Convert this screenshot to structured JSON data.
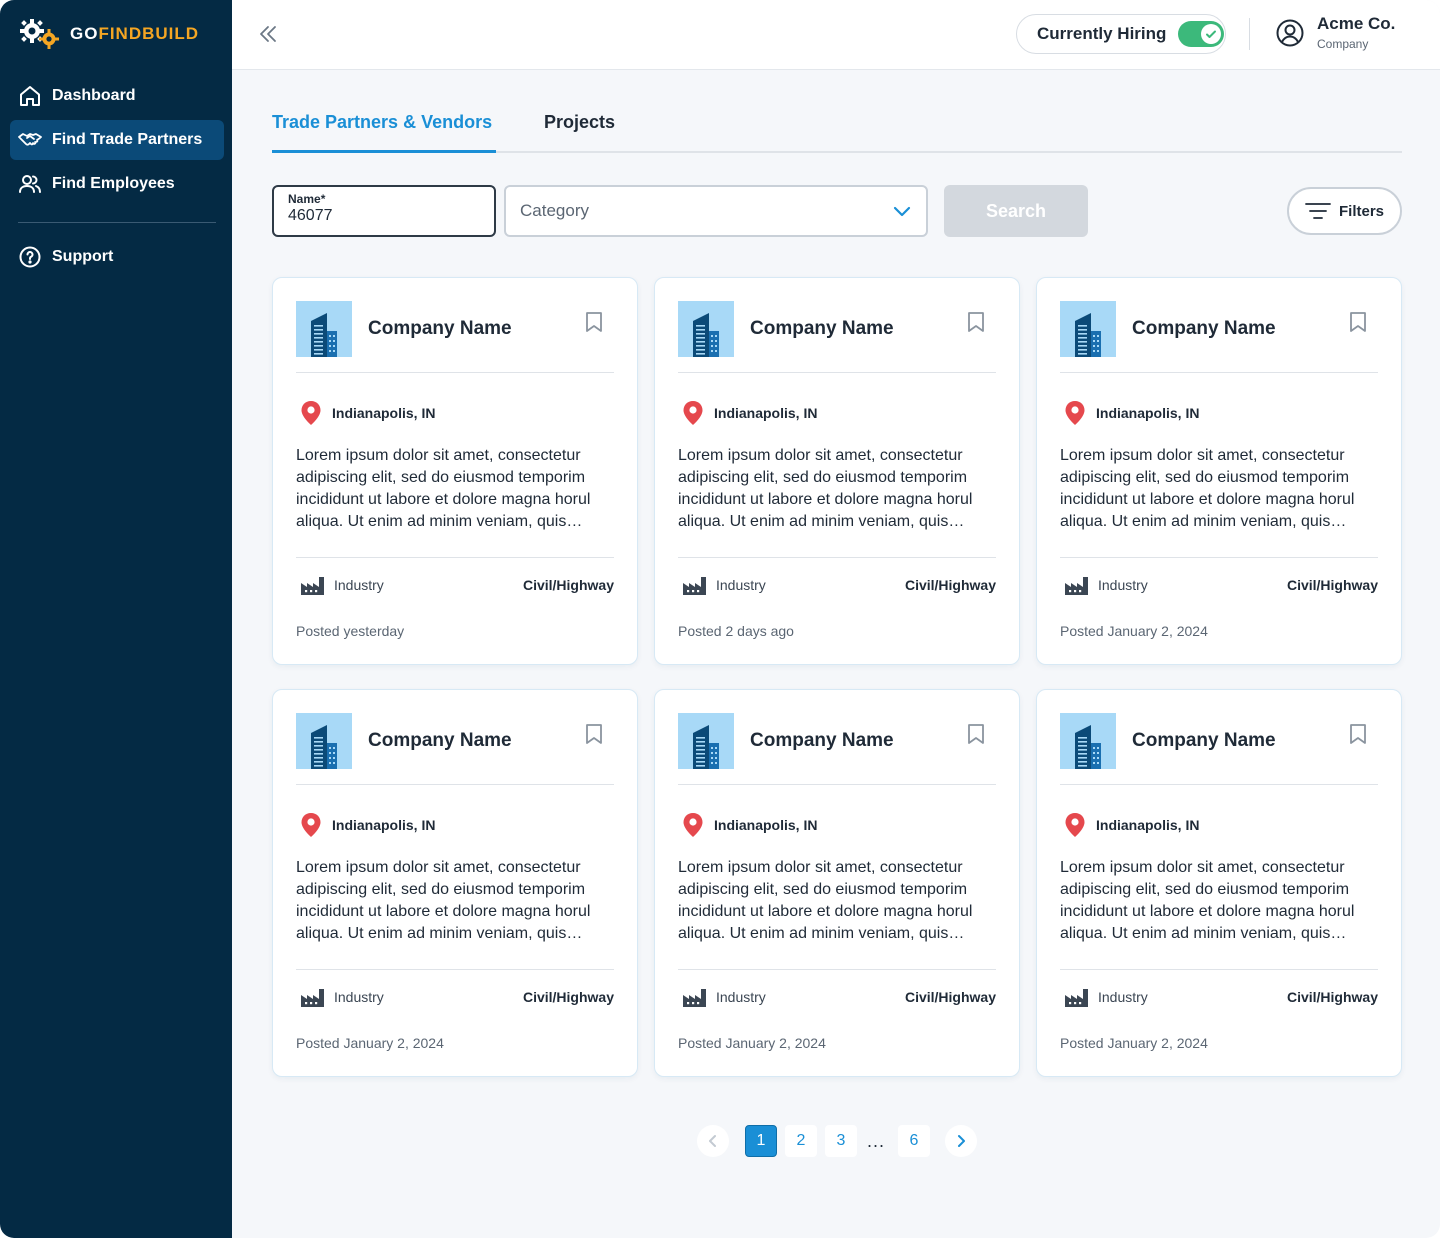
{
  "brand": {
    "part1": "GO",
    "part2": "FIND",
    "part3": "BUILD"
  },
  "sidebar": {
    "items": [
      {
        "label": "Dashboard",
        "icon": "home-icon"
      },
      {
        "label": "Find Trade Partners",
        "icon": "handshake-icon"
      },
      {
        "label": "Find Employees",
        "icon": "users-icon"
      }
    ],
    "support": {
      "label": "Support",
      "icon": "help-circle-icon"
    }
  },
  "topbar": {
    "hiring_label": "Currently Hiring",
    "hiring_on": true,
    "account_name": "Acme Co.",
    "account_role": "Company"
  },
  "tabs": [
    {
      "label": "Trade Partners & Vendors",
      "active": true
    },
    {
      "label": "Projects",
      "active": false
    }
  ],
  "search": {
    "name_label": "Name",
    "name_required": "*",
    "name_value": "46077",
    "category_placeholder": "Category",
    "search_label": "Search",
    "filters_label": "Filters"
  },
  "cards": [
    {
      "company": "Company Name",
      "location": "Indianapolis, IN",
      "description": "Lorem ipsum dolor sit amet, consectetur adipiscing elit, sed do eiusmod temporim incididunt ut labore et dolore magna horul aliqua. Ut enim ad minim veniam, quis nostrud",
      "industry_label": "Industry",
      "industry": "Civil/Highway",
      "posted": "Posted yesterday"
    },
    {
      "company": "Company Name",
      "location": "Indianapolis, IN",
      "description": "Lorem ipsum dolor sit amet, consectetur adipiscing elit, sed do eiusmod temporim incididunt ut labore et dolore magna horul aliqua. Ut enim ad minim veniam, quis nostrud",
      "industry_label": "Industry",
      "industry": "Civil/Highway",
      "posted": "Posted 2 days ago"
    },
    {
      "company": "Company Name",
      "location": "Indianapolis, IN",
      "description": "Lorem ipsum dolor sit amet, consectetur adipiscing elit, sed do eiusmod temporim incididunt ut labore et dolore magna horul aliqua. Ut enim ad minim veniam, quis nostrud",
      "industry_label": "Industry",
      "industry": "Civil/Highway",
      "posted": "Posted January 2, 2024"
    },
    {
      "company": "Company Name",
      "location": "Indianapolis, IN",
      "description": "Lorem ipsum dolor sit amet, consectetur adipiscing elit, sed do eiusmod temporim incididunt ut labore et dolore magna horul aliqua. Ut enim ad minim veniam, quis nostrud",
      "industry_label": "Industry",
      "industry": "Civil/Highway",
      "posted": "Posted January 2, 2024"
    },
    {
      "company": "Company Name",
      "location": "Indianapolis, IN",
      "description": "Lorem ipsum dolor sit amet, consectetur adipiscing elit, sed do eiusmod temporim incididunt ut labore et dolore magna horul aliqua. Ut enim ad minim veniam, quis nostrud",
      "industry_label": "Industry",
      "industry": "Civil/Highway",
      "posted": "Posted January 2, 2024"
    },
    {
      "company": "Company Name",
      "location": "Indianapolis, IN",
      "description": "Lorem ipsum dolor sit amet, consectetur adipiscing elit, sed do eiusmod temporim incididunt ut labore et dolore magna horul aliqua. Ut enim ad minim veniam, quis nostrud",
      "industry_label": "Industry",
      "industry": "Civil/Highway",
      "posted": "Posted January 2, 2024"
    }
  ],
  "pagination": {
    "pages": [
      "1",
      "2",
      "3",
      "6"
    ],
    "current": "1",
    "ellipsis": "..."
  },
  "colors": {
    "sidebar_bg": "#042a44",
    "accent": "#1a8fd6",
    "brand_orange": "#f5a623",
    "toggle_on": "#3cb97b",
    "pin_red": "#e5484d"
  }
}
